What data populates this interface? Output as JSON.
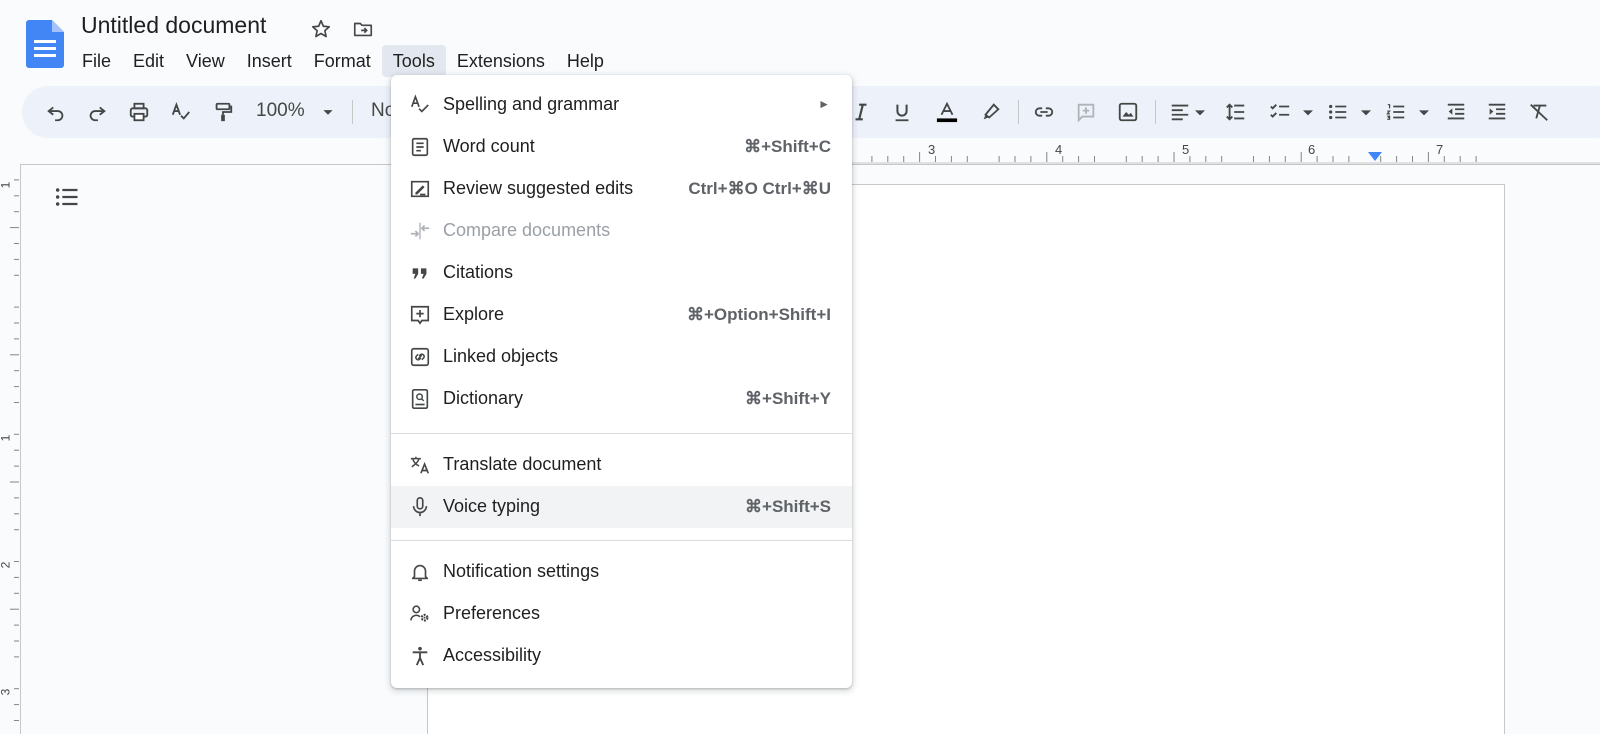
{
  "doc": {
    "title": "Untitled document"
  },
  "menubar": {
    "items": [
      {
        "label": "File"
      },
      {
        "label": "Edit"
      },
      {
        "label": "View"
      },
      {
        "label": "Insert"
      },
      {
        "label": "Format"
      },
      {
        "label": "Tools",
        "active": true
      },
      {
        "label": "Extensions"
      },
      {
        "label": "Help"
      }
    ]
  },
  "toolbar": {
    "zoom": "100%",
    "style_partial": "Normal text"
  },
  "ruler": {
    "numbers": [
      "3",
      "4",
      "5",
      "6",
      "7"
    ]
  },
  "vruler": {
    "numbers": [
      "1",
      "1",
      "2",
      "3"
    ]
  },
  "tools_menu": {
    "items": [
      {
        "label": "Spelling and grammar",
        "icon": "spellcheck-icon",
        "submenu": true,
        "arrow": "►"
      },
      {
        "label": "Word count",
        "icon": "word-count-icon",
        "shortcut": "⌘+Shift+C"
      },
      {
        "label": "Review suggested edits",
        "icon": "review-edits-icon",
        "shortcut": "Ctrl+⌘O Ctrl+⌘U"
      },
      {
        "label": "Compare documents",
        "icon": "compare-icon",
        "disabled": true
      },
      {
        "label": "Citations",
        "icon": "citations-icon"
      },
      {
        "label": "Explore",
        "icon": "explore-icon",
        "shortcut": "⌘+Option+Shift+I"
      },
      {
        "label": "Linked objects",
        "icon": "linked-objects-icon"
      },
      {
        "label": "Dictionary",
        "icon": "dictionary-icon",
        "shortcut": "⌘+Shift+Y"
      },
      {
        "label": "Translate document",
        "icon": "translate-icon"
      },
      {
        "label": "Voice typing",
        "icon": "microphone-icon",
        "shortcut": "⌘+Shift+S",
        "highlighted": true
      },
      {
        "label": "Notification settings",
        "icon": "bell-icon"
      },
      {
        "label": "Preferences",
        "icon": "preferences-icon"
      },
      {
        "label": "Accessibility",
        "icon": "accessibility-icon"
      }
    ]
  },
  "colors": {
    "accent": "#1a73e8",
    "toolbar_bg": "#edf2fa",
    "menu_active": "#e3e8f0",
    "menu_hover": "#f1f3f4",
    "ruler_marker": "#4285f4"
  }
}
